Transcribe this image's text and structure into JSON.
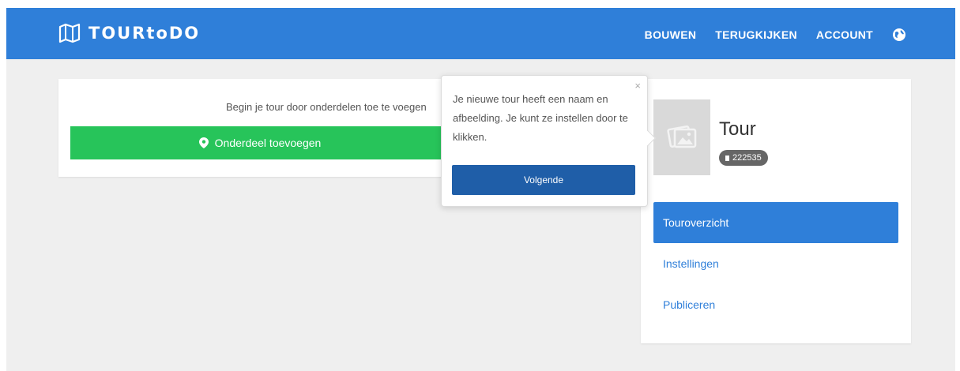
{
  "header": {
    "logo_text": "TOURtoDO",
    "nav": [
      "BOUWEN",
      "TERUGKIJKEN",
      "ACCOUNT"
    ],
    "globe_icon": "globe-icon",
    "bar_color": "#2f7fd9"
  },
  "main": {
    "intro": "Begin je tour door onderdelen toe te voegen",
    "add_button_label": "Onderdeel toevoegen",
    "add_button_color": "#27c45a"
  },
  "tour": {
    "name": "Tour",
    "id": "222535",
    "image_icon": "image-placeholder-icon"
  },
  "menu": {
    "items": [
      "Touroverzicht",
      "Instellingen",
      "Publiceren"
    ],
    "active_index": 0
  },
  "popover": {
    "text": "Je nieuwe tour heeft een naam en afbeelding. Je kunt ze instellen door te klikken.",
    "button_label": "Volgende",
    "close_label": "×",
    "button_color": "#1f5ea8"
  }
}
